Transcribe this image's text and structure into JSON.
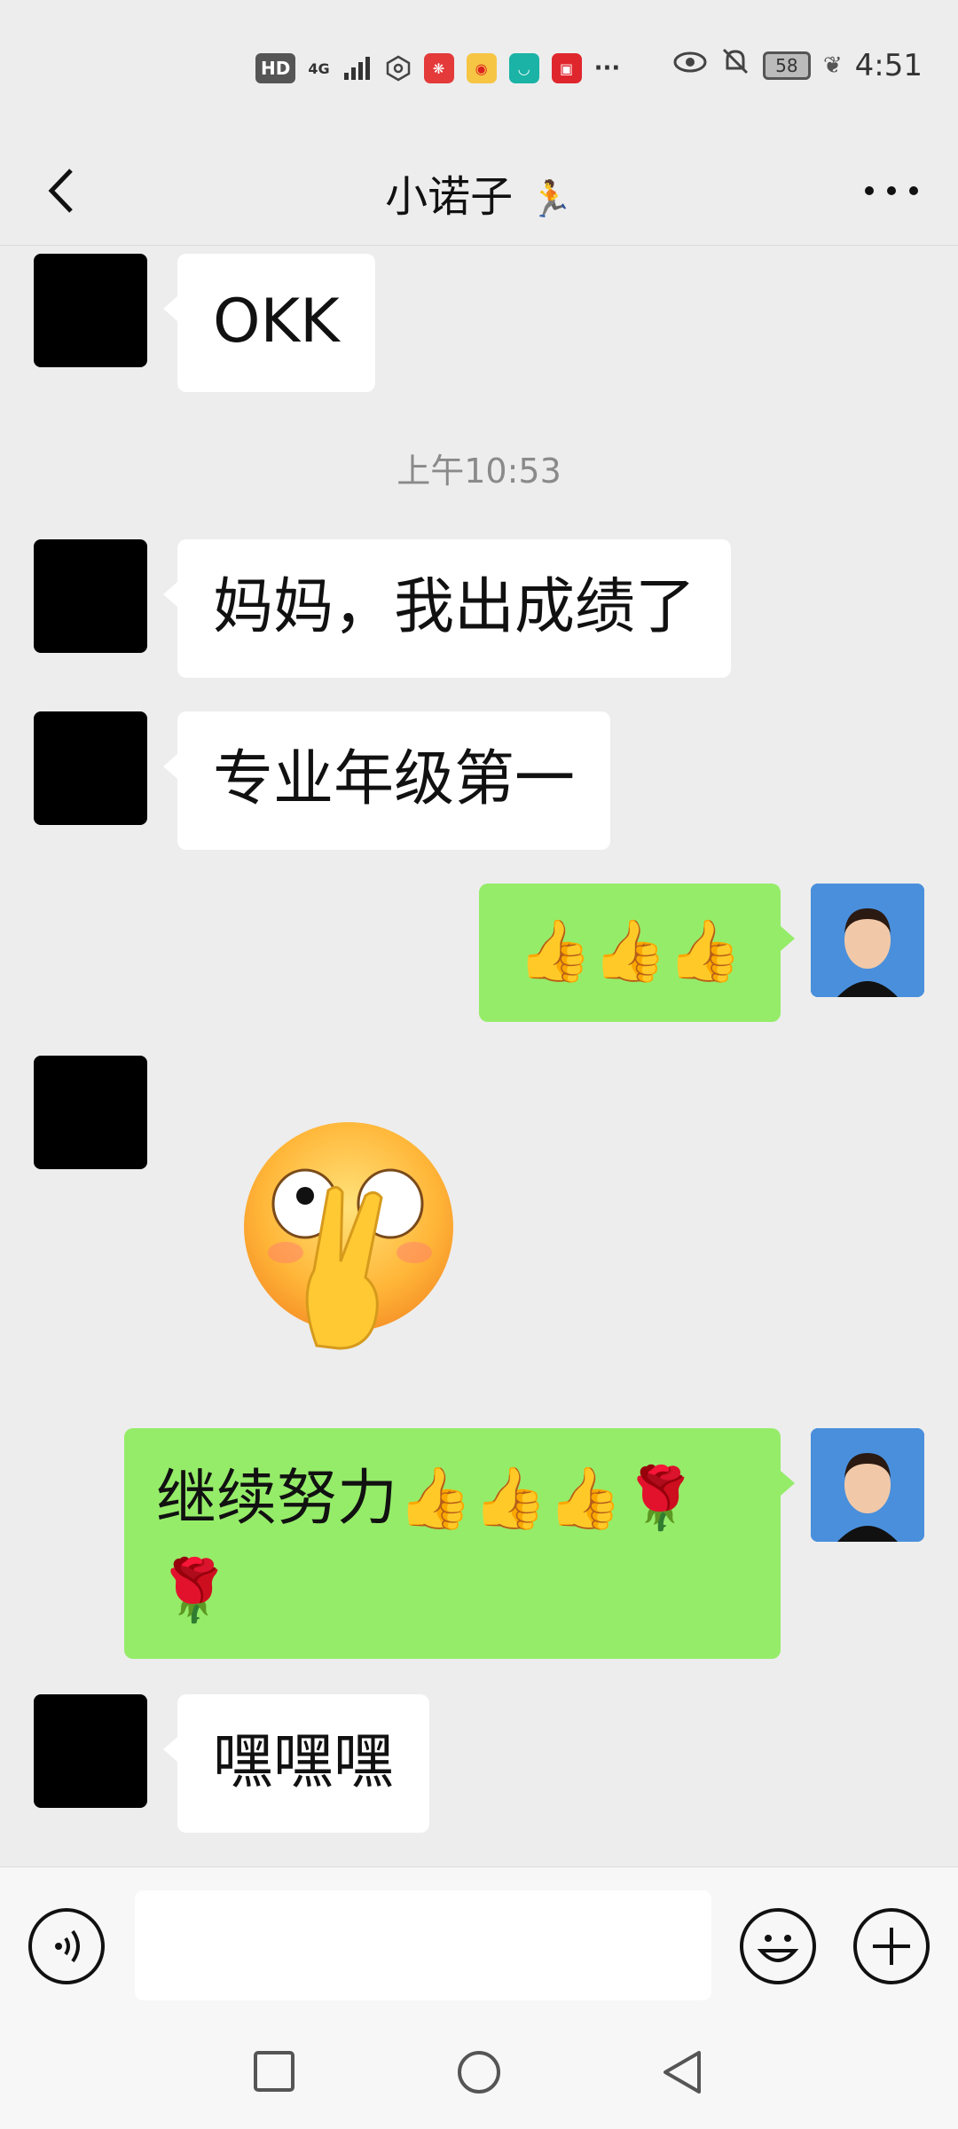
{
  "status_bar": {
    "left_icons": [
      "HD",
      "4G",
      "signal-icon",
      "hexagon-icon",
      "app-icon",
      "weibo-icon",
      "app-icon",
      "app-icon"
    ],
    "hd_label": "HD",
    "network_label": "4G",
    "overflow": "···",
    "battery": "58",
    "time": "4:51"
  },
  "header": {
    "title": "小诺子"
  },
  "messages": [
    {
      "side": "in",
      "text": "OKK"
    },
    {
      "type": "timestamp",
      "text": "上午10:53"
    },
    {
      "side": "in",
      "text": "妈妈，我出成绩了"
    },
    {
      "side": "in",
      "text": "专业年级第一"
    },
    {
      "side": "out",
      "text": "👍👍👍"
    },
    {
      "side": "in",
      "type": "sticker",
      "sticker": "eye-peace-emoji"
    },
    {
      "side": "out",
      "text_line1": "继续努力👍👍👍🌹",
      "text_line2": "🌹"
    },
    {
      "side": "in",
      "text": "嘿嘿嘿"
    }
  ],
  "colors": {
    "background": "#ededed",
    "outgoing_bubble": "#95ec69",
    "incoming_bubble": "#ffffff",
    "timestamp_text": "#8a8a8a"
  }
}
